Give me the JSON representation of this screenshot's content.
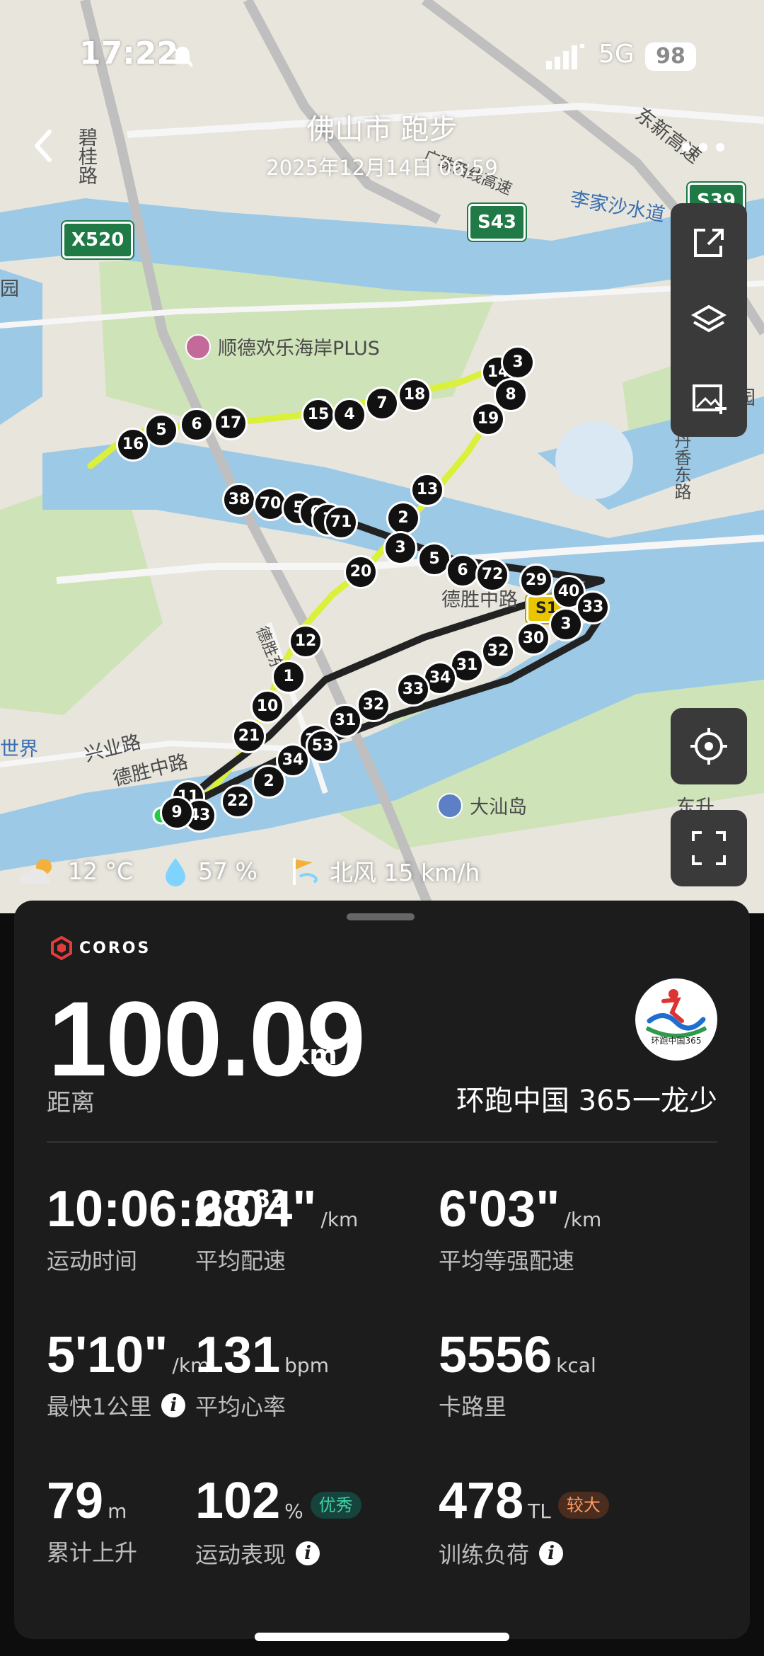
{
  "status_bar": {
    "time": "17:22",
    "network": "5G",
    "battery": "98"
  },
  "header": {
    "title": "佛山市 跑步",
    "subtitle": "2025年12月14日 06:59"
  },
  "map": {
    "labels": [
      {
        "text": "碧桂路",
        "cls": ""
      },
      {
        "text": "东新高速",
        "cls": ""
      },
      {
        "text": "广珠西线高速",
        "cls": ""
      },
      {
        "text": "李家沙水道",
        "cls": "blue"
      },
      {
        "text": "顺德欢乐海岸PLUS",
        "cls": ""
      },
      {
        "text": "德胜中路",
        "cls": ""
      },
      {
        "text": "德胜中路",
        "cls": ""
      },
      {
        "text": "兴业路",
        "cls": ""
      },
      {
        "text": "大汕岛",
        "cls": ""
      },
      {
        "text": "东升",
        "cls": ""
      },
      {
        "text": "世界",
        "cls": "blue"
      },
      {
        "text": "园",
        "cls": ""
      },
      {
        "text": "成园",
        "cls": ""
      },
      {
        "text": "丹香东路",
        "cls": ""
      }
    ],
    "shields": [
      "X520",
      "S43",
      "S39",
      "S1",
      "S4"
    ],
    "km_markers": [
      "16",
      "5",
      "6",
      "17",
      "15",
      "4",
      "7",
      "18",
      "14",
      "3",
      "8",
      "19",
      "13",
      "2",
      "20",
      "12",
      "1",
      "10",
      "21",
      "11",
      "43",
      "9",
      "22",
      "2",
      "38",
      "70",
      "5",
      "6",
      "7",
      "71",
      "3",
      "5",
      "6",
      "72",
      "29",
      "40",
      "33",
      "3",
      "30",
      "32",
      "31",
      "34",
      "33",
      "32",
      "31",
      "35",
      "34",
      "53"
    ],
    "route_color": "#dbf03a"
  },
  "weather": {
    "temperature": "12 °C",
    "humidity": "57 %",
    "wind": "北风 15 km/h"
  },
  "panel": {
    "brand": "COROS",
    "distance": "100.09",
    "distance_unit": "km",
    "distance_label": "距离",
    "team_name": "环跑中国 365一龙少",
    "stats": {
      "duration": {
        "value": "10:06:28",
        "sup": "83",
        "label": "运动时间"
      },
      "avg_pace": {
        "value": "6'04\"",
        "unit": "/km",
        "label": "平均配速"
      },
      "avg_grade_pace": {
        "value": "6'03\"",
        "unit": "/km",
        "label": "平均等强配速"
      },
      "fastest_km": {
        "value": "5'10\"",
        "unit": "/km",
        "label": "最快1公里"
      },
      "avg_hr": {
        "value": "131",
        "unit": "bpm",
        "label": "平均心率"
      },
      "calories": {
        "value": "5556",
        "unit": "kcal",
        "label": "卡路里"
      },
      "ascent": {
        "value": "79",
        "unit": "m",
        "label": "累计上升"
      },
      "performance": {
        "value": "102",
        "unit": "%",
        "badge": "优秀",
        "label": "运动表现"
      },
      "training_load": {
        "value": "478",
        "unit": "TL",
        "badge": "较大",
        "label": "训练负荷"
      }
    }
  },
  "colors": {
    "panel_bg": "#1c1c1c",
    "accent_green": "#3ed0a8",
    "accent_orange": "#ff9b62",
    "map_water": "#9cc9e6",
    "map_park": "#cfe3b8"
  }
}
